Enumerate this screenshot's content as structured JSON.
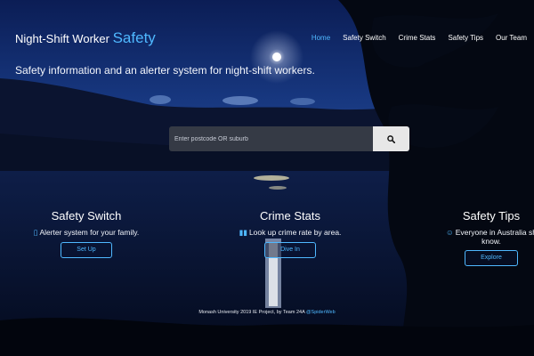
{
  "brand": {
    "prefix": "Night-Shift Worker",
    "accent": "Safety"
  },
  "nav": {
    "items": [
      {
        "label": "Home",
        "active": true
      },
      {
        "label": "Safety Switch",
        "active": false
      },
      {
        "label": "Crime Stats",
        "active": false
      },
      {
        "label": "Safety Tips",
        "active": false
      },
      {
        "label": "Our Team",
        "active": false
      }
    ]
  },
  "hero": {
    "tagline": "Safety information and an alerter system for night-shift workers."
  },
  "search": {
    "placeholder": "Enter postcode OR suburb",
    "button_icon": "search-icon"
  },
  "features": [
    {
      "title": "Safety Switch",
      "icon": "phone-icon",
      "description": "Alerter system for your family.",
      "button": "Set Up"
    },
    {
      "title": "Crime Stats",
      "icon": "bar-chart-icon",
      "description": "Look up crime rate by area.",
      "button": "Dive In"
    },
    {
      "title": "Safety Tips",
      "icon": "smile-icon",
      "description": "Everyone in Australia sh",
      "description_line2": "know.",
      "button": "Explore"
    }
  ],
  "footer": {
    "text": "Monash University 2019 IE Project, by Team 24A ",
    "link": "@SpiderWeb"
  },
  "colors": {
    "accent": "#4fb8ff",
    "night_sky": "#0a1a4a",
    "lake": "#0b1636"
  }
}
